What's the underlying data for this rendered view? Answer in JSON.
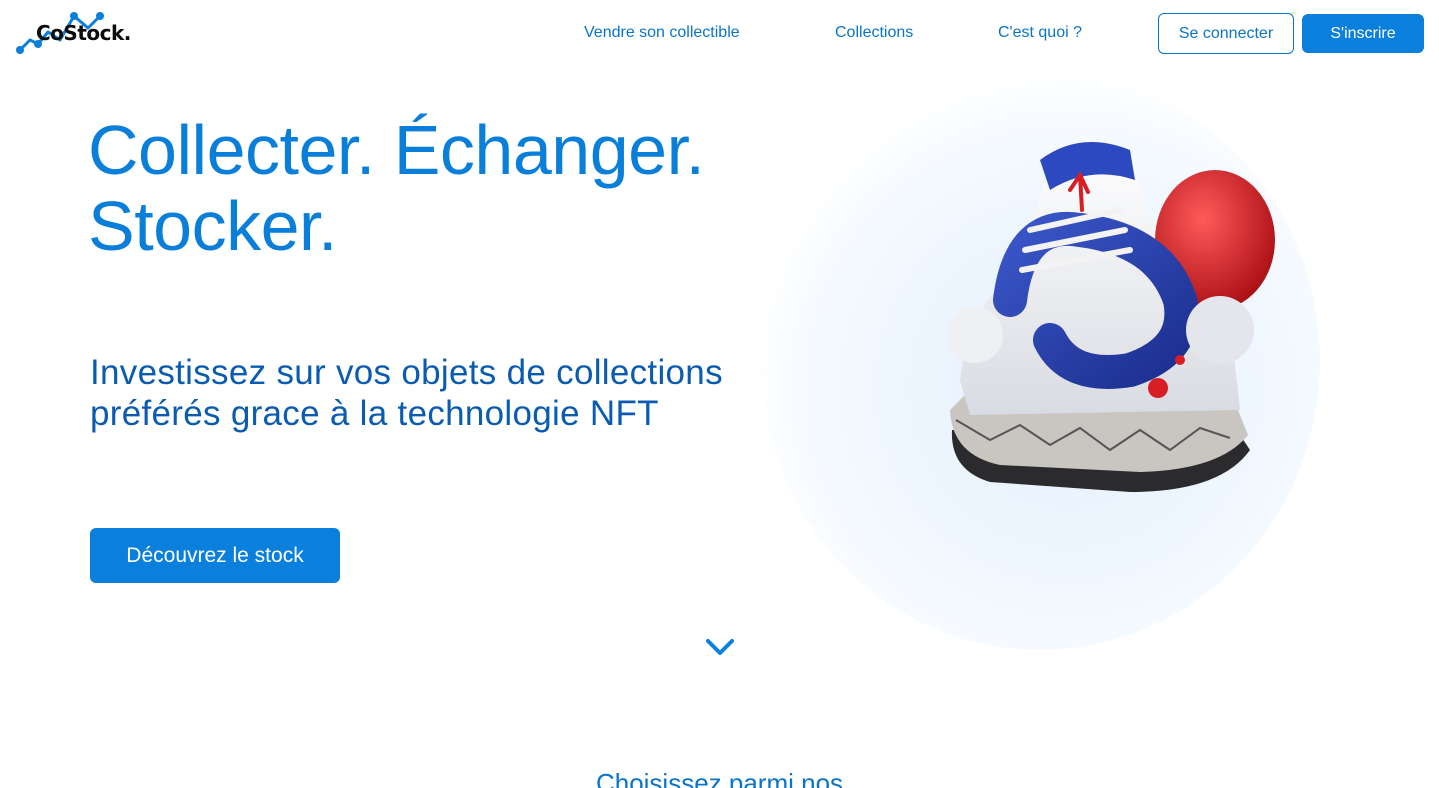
{
  "brand": {
    "name": "CoStock.",
    "logo_icon": "line-graph-icon",
    "accent_color": "#0a7fdc",
    "dark_blue": "#0b5cb0"
  },
  "nav": {
    "items": [
      {
        "label": "Vendre son collectible"
      },
      {
        "label": "Collections"
      },
      {
        "label": "C'est quoi ?"
      }
    ],
    "login_label": "Se connecter",
    "signup_label": "S'inscrire"
  },
  "hero": {
    "title_line1": "Collecter. Échanger.",
    "title_line2": "Stocker.",
    "subtitle_line1": "Investissez sur vos objets de collections",
    "subtitle_line2": "préférés grace à la technologie NFT",
    "cta_label": "Découvrez le stock",
    "image_subject": "sneaker-illustration"
  },
  "scroll_icon": "chevron-down-icon",
  "next_section": {
    "heading": "Choisissez parmi nos"
  }
}
